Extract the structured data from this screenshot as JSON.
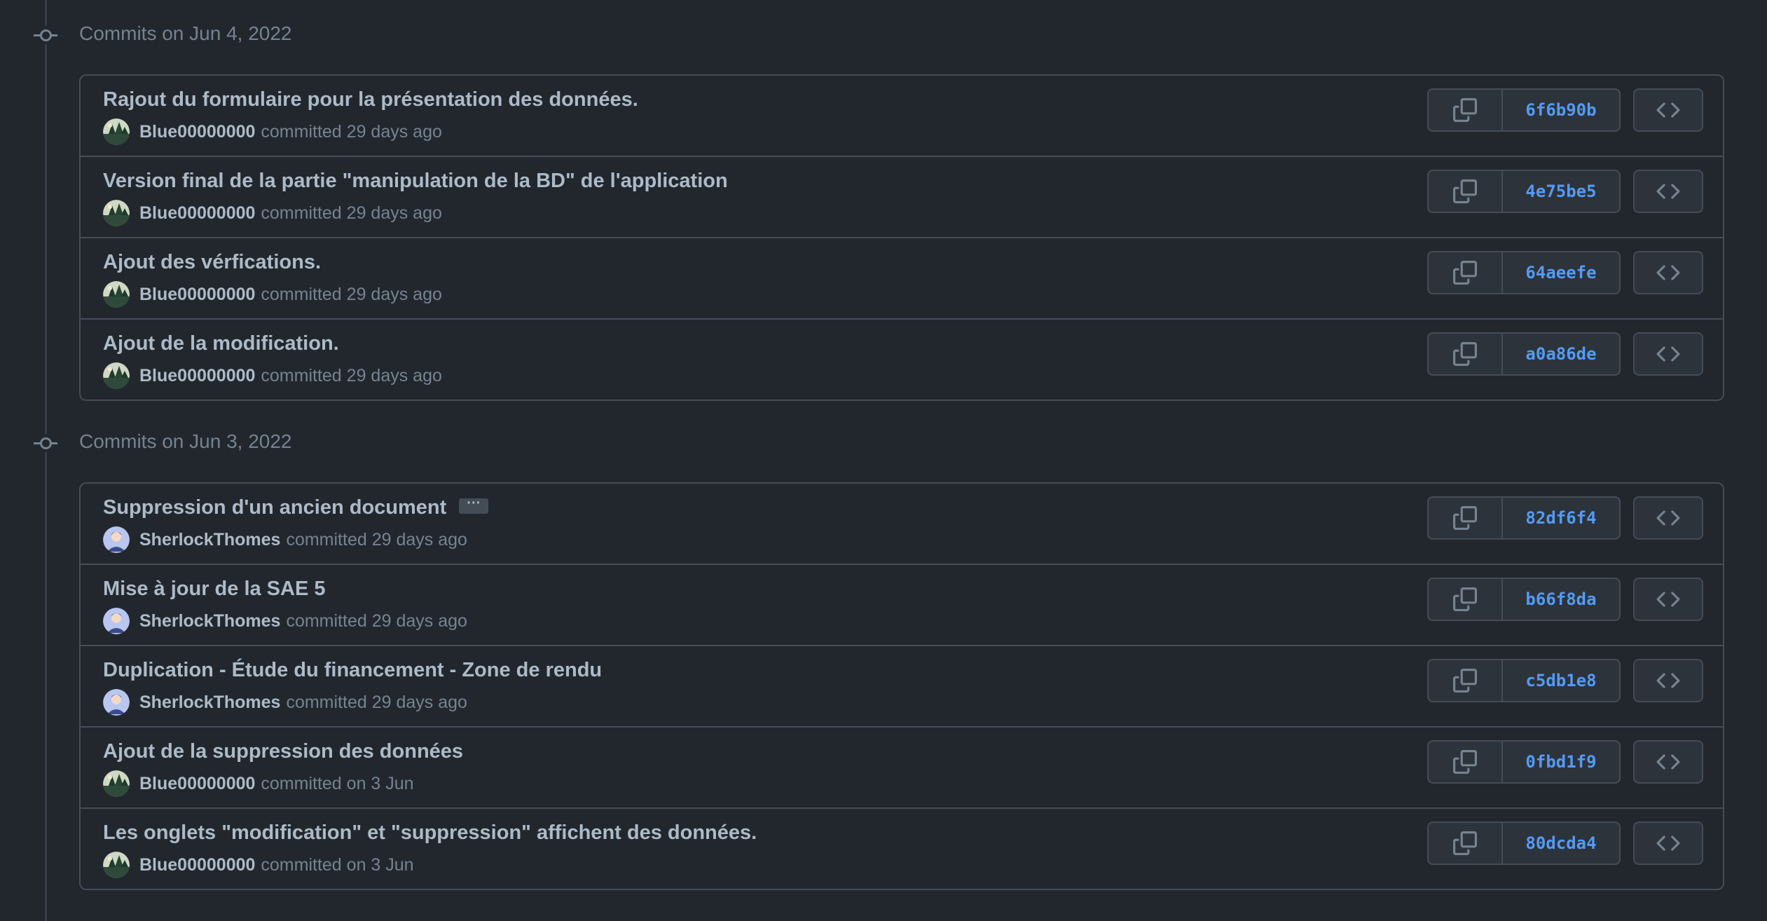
{
  "groups": [
    {
      "title": "Commits on Jun 4, 2022",
      "commits": [
        {
          "message": "Rajout du formulaire pour la présentation des données.",
          "author": "Blue00000000",
          "time": "committed 29 days ago",
          "sha": "6f6b90b",
          "avatar": "blue"
        },
        {
          "message": "Version final de la partie \"manipulation de la BD\" de l'application",
          "author": "Blue00000000",
          "time": "committed 29 days ago",
          "sha": "4e75be5",
          "avatar": "blue"
        },
        {
          "message": "Ajout des vérfications.",
          "author": "Blue00000000",
          "time": "committed 29 days ago",
          "sha": "64aeefe",
          "avatar": "blue"
        },
        {
          "message": "Ajout de la modification.",
          "author": "Blue00000000",
          "time": "committed 29 days ago",
          "sha": "a0a86de",
          "avatar": "blue"
        }
      ]
    },
    {
      "title": "Commits on Jun 3, 2022",
      "commits": [
        {
          "message": "Suppression d'un ancien document",
          "author": "SherlockThomes",
          "time": "committed 29 days ago",
          "sha": "82df6f4",
          "avatar": "sherlock",
          "has_more": true,
          "more_label": "···"
        },
        {
          "message": "Mise à jour de la SAE 5",
          "author": "SherlockThomes",
          "time": "committed 29 days ago",
          "sha": "b66f8da",
          "avatar": "sherlock"
        },
        {
          "message": "Duplication - Étude du financement - Zone de rendu",
          "author": "SherlockThomes",
          "time": "committed 29 days ago",
          "sha": "c5db1e8",
          "avatar": "sherlock"
        },
        {
          "message": "Ajout de la suppression des données",
          "author": "Blue00000000",
          "time": "committed on 3 Jun",
          "sha": "0fbd1f9",
          "avatar": "blue"
        },
        {
          "message": "Les onglets \"modification\" et \"suppression\" affichent des données.",
          "author": "Blue00000000",
          "time": "committed on 3 Jun",
          "sha": "80dcda4",
          "avatar": "blue"
        }
      ]
    }
  ],
  "icons": {
    "copy": "copy-icon",
    "browse": "code-icon",
    "node": "git-commit-icon"
  },
  "colors": {
    "background": "#22272e",
    "border": "#444c56",
    "sha": "#539bf5",
    "muted": "#768390",
    "text": "#adbac7"
  }
}
